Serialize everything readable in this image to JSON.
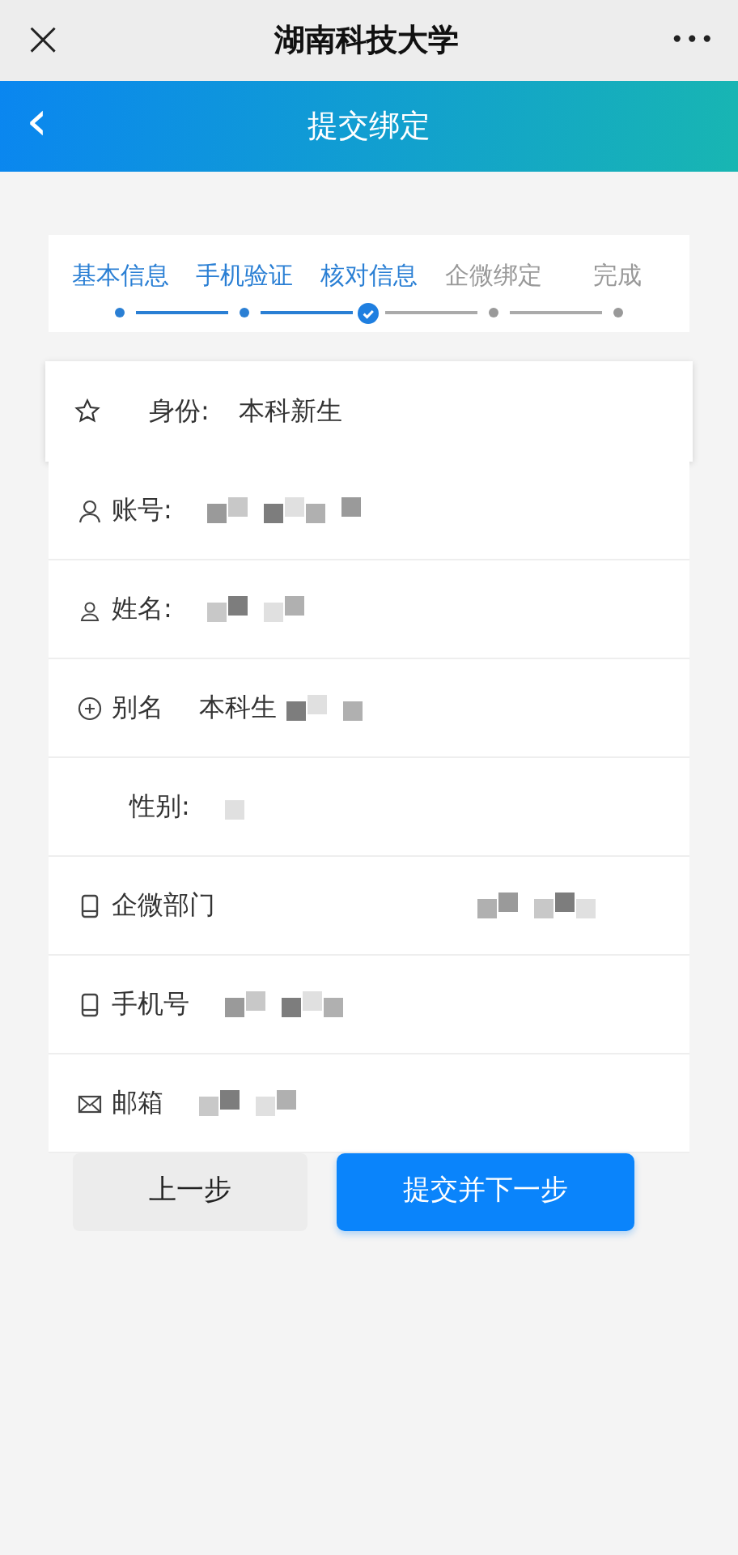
{
  "top_bar": {
    "title": "湖南科技大学",
    "close": "×",
    "more": "•••"
  },
  "header": {
    "back": "‹",
    "title": "提交绑定"
  },
  "steps": [
    {
      "label": "基本信息",
      "done": true,
      "selected": false
    },
    {
      "label": "手机验证",
      "done": true,
      "selected": false
    },
    {
      "label": "核对信息",
      "done": true,
      "selected": true
    },
    {
      "label": "企微绑定",
      "done": false,
      "selected": false
    },
    {
      "label": "完成",
      "done": false,
      "selected": false
    }
  ],
  "identity": {
    "label": "身份:",
    "value": "本科新生"
  },
  "fields": [
    {
      "kind": "account",
      "label": "账号:",
      "redacted": true
    },
    {
      "kind": "name",
      "label": "姓名:",
      "redacted": true
    },
    {
      "kind": "alias",
      "label": "别名",
      "value": "本科生",
      "redacted": true
    },
    {
      "kind": "gender",
      "label": "性别:",
      "redacted": true
    },
    {
      "kind": "department",
      "label": "企微部门",
      "redacted": true
    },
    {
      "kind": "phone",
      "label": "手机号",
      "redacted": true
    },
    {
      "kind": "email",
      "label": "邮箱",
      "redacted": true
    }
  ],
  "buttons": [
    {
      "kind": "secondary",
      "label": "上一步"
    },
    {
      "kind": "primary",
      "label": "提交并下一步"
    }
  ]
}
